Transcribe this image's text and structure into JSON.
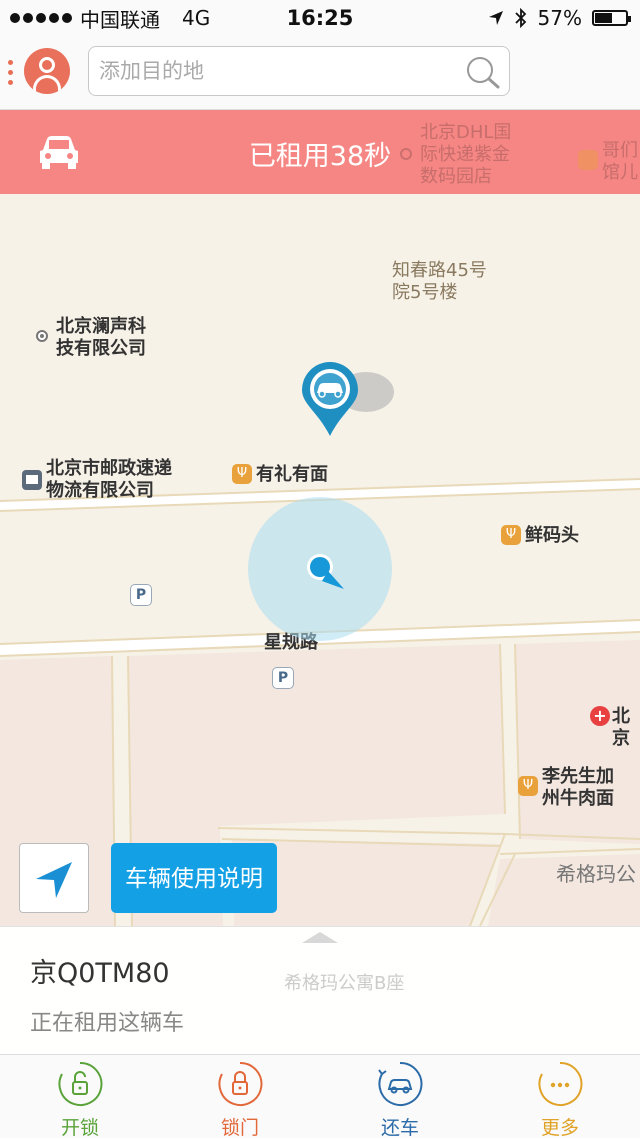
{
  "status_bar": {
    "carrier": "中国联通",
    "network": "4G",
    "time": "16:25",
    "battery": "57%",
    "battery_level": 0.57
  },
  "header": {
    "search_placeholder": "添加目的地"
  },
  "banner": {
    "text": "已租用38秒",
    "color": "#f68683"
  },
  "map": {
    "labels": {
      "dhl": "北京DHL国\n际快递紫金\n数码园店",
      "gege": "哥们\n馆儿",
      "zhichun": "知春路45号\n院5号楼",
      "lansheng": "北京澜声科\n技有限公司",
      "postal": "北京市邮政速递\n物流有限公司",
      "youli": "有礼有面",
      "xianmatou": "鲜码头",
      "xinggui": "星规路",
      "beijing_hosp": "北京",
      "lixiansheng": "李先生加\n州牛肉面",
      "xigema": "希格玛公"
    }
  },
  "buttons": {
    "guide": "车辆使用说明"
  },
  "vehicle": {
    "plate": "京Q0TM80",
    "status": "正在租用这辆车",
    "ghost_label": "希格玛公寓B座"
  },
  "tabs": [
    {
      "label": "开锁",
      "color": "#5aa33a",
      "icon": "unlock-icon"
    },
    {
      "label": "锁门",
      "color": "#e2683a",
      "icon": "lock-icon"
    },
    {
      "label": "还车",
      "color": "#2b6ba8",
      "icon": "return-car-icon"
    },
    {
      "label": "更多",
      "color": "#e0a328",
      "icon": "more-icon"
    }
  ]
}
